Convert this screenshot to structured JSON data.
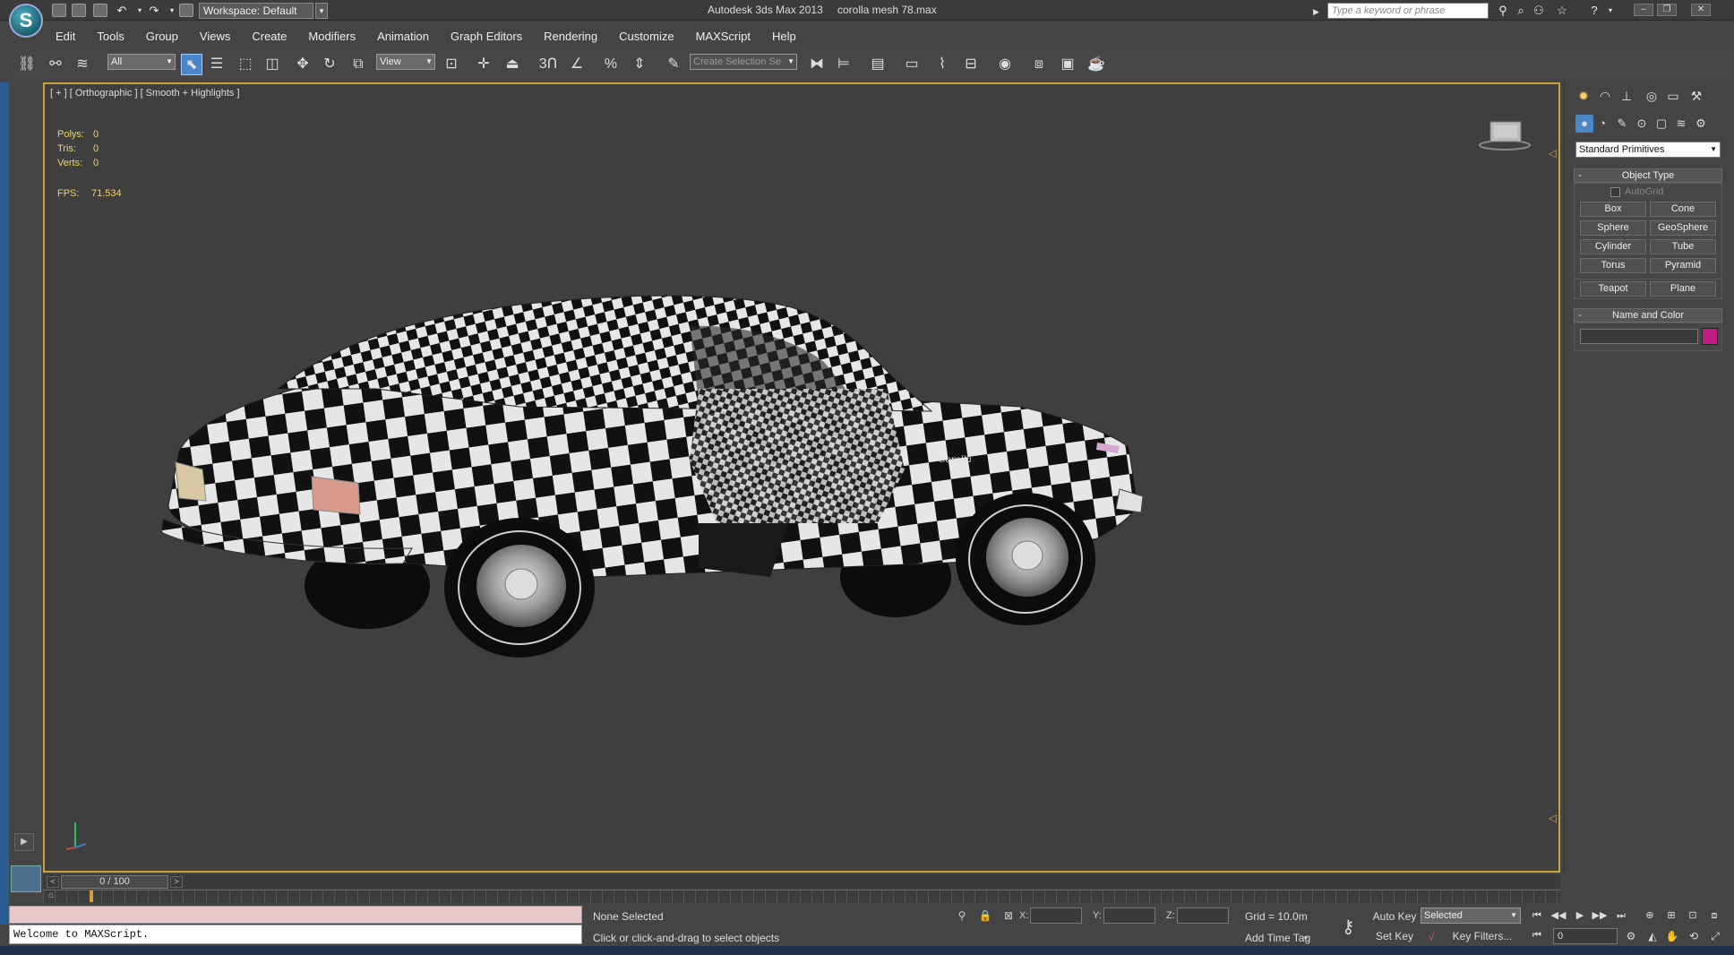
{
  "window": {
    "app_title": "Autodesk 3ds Max  2013",
    "file_name": "corolla mesh 78.max",
    "workspace": "Workspace: Default",
    "search_placeholder": "Type a keyword or phrase"
  },
  "menu": [
    "Edit",
    "Tools",
    "Group",
    "Views",
    "Create",
    "Modifiers",
    "Animation",
    "Graph Editors",
    "Rendering",
    "Customize",
    "MAXScript",
    "Help"
  ],
  "toolbar": {
    "selection_filter": "All",
    "reference_coord": "View",
    "named_selection_placeholder": "Create Selection Se",
    "snap_label": "3"
  },
  "viewport": {
    "label": "[ + ] [ Orthographic ] [ Smooth + Highlights ]",
    "stats": [
      {
        "label": "Polys:",
        "value": "0"
      },
      {
        "label": "Tris:",
        "value": "0"
      },
      {
        "label": "Verts:",
        "value": "0"
      }
    ],
    "fps_label": "FPS:",
    "fps_value": "71.534",
    "car_badge": "Corolla",
    "colors": {
      "border_active": "#c9a33a",
      "stat_text": "#f1d26a",
      "background": "#3f3f3f"
    }
  },
  "command_panel": {
    "category": "Standard Primitives",
    "object_type_title": "Object Type",
    "autogrid_label": "AutoGrid",
    "primitives": [
      "Box",
      "Cone",
      "Sphere",
      "GeoSphere",
      "Cylinder",
      "Tube",
      "Torus",
      "Pyramid",
      "Teapot",
      "Plane"
    ],
    "name_color_title": "Name and Color",
    "color": "#c21a85"
  },
  "time_slider": {
    "position": "0 / 100"
  },
  "status": {
    "maxscript_output": "Welcome to MAXScript.",
    "selection": "None Selected",
    "prompt": "Click or click-and-drag to select objects",
    "x_label": "X:",
    "y_label": "Y:",
    "z_label": "Z:",
    "grid": "Grid = 10.0m",
    "add_time_tag": "Add Time Tag",
    "auto_key": "Auto Key",
    "set_key": "Set Key",
    "key_mode": "Selected",
    "key_filters": "Key Filters...",
    "current_frame": "0"
  }
}
